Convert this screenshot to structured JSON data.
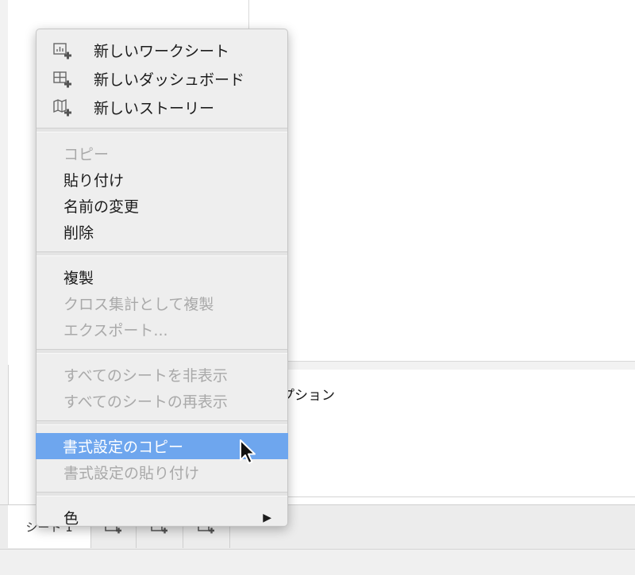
{
  "menu": {
    "new_items": [
      {
        "label": "新しいワークシート",
        "icon": "new-worksheet-icon"
      },
      {
        "label": "新しいダッシュボード",
        "icon": "new-dashboard-icon"
      },
      {
        "label": "新しいストーリー",
        "icon": "new-story-icon"
      }
    ],
    "edit_items": [
      {
        "label": "コピー",
        "enabled": false
      },
      {
        "label": "貼り付け",
        "enabled": true
      },
      {
        "label": "名前の変更",
        "enabled": true
      },
      {
        "label": "削除",
        "enabled": true
      }
    ],
    "dup_items": [
      {
        "label": "複製",
        "enabled": true
      },
      {
        "label": "クロス集計として複製",
        "enabled": false
      },
      {
        "label": "エクスポート...",
        "enabled": false
      }
    ],
    "sheet_items": [
      {
        "label": "すべてのシートを非表示",
        "enabled": false
      },
      {
        "label": "すべてのシートの再表示",
        "enabled": false
      }
    ],
    "format_items": [
      {
        "label": "書式設定のコピー",
        "enabled": true,
        "highlighted": true
      },
      {
        "label": "書式設定の貼り付け",
        "enabled": false
      }
    ],
    "color_item": {
      "label": "色",
      "submenu_icon": "triangle-right-icon"
    }
  },
  "background": {
    "caption_text": "プション",
    "active_tab_label": "シート 1",
    "tab_icons": [
      "new-worksheet-icon",
      "new-dashboard-icon",
      "new-story-icon"
    ]
  },
  "colors": {
    "highlight": "#6ea6ee",
    "disabled_text": "#a9a9a9",
    "menu_bg": "#eeeeee"
  }
}
